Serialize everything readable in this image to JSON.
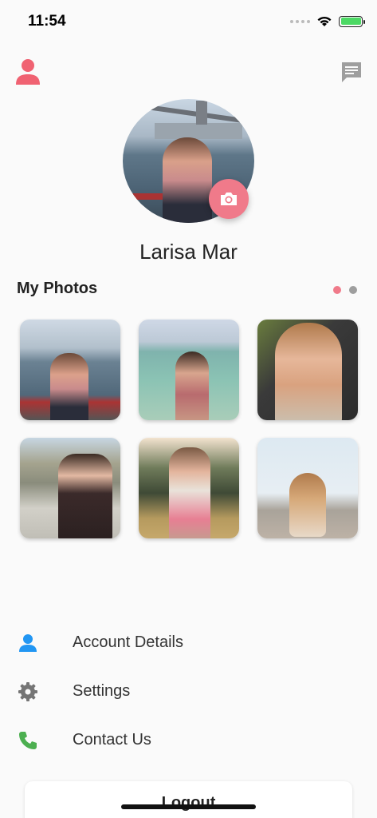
{
  "status_bar": {
    "time": "11:54"
  },
  "profile": {
    "name": "Larisa Mar"
  },
  "photos_section": {
    "title": "My Photos",
    "page_count": 2,
    "active_page": 1
  },
  "photos": [
    {
      "subject": "woman at waterfront by bridge"
    },
    {
      "subject": "woman in sea"
    },
    {
      "subject": "woman selfie in car"
    },
    {
      "subject": "woman sitting by river"
    },
    {
      "subject": "woman outdoors with sunglasses"
    },
    {
      "subject": "dog on beach"
    }
  ],
  "menu": [
    {
      "label": "Account Details",
      "icon": "person-icon",
      "color": "#2196f3"
    },
    {
      "label": "Settings",
      "icon": "gear-icon",
      "color": "#757575"
    },
    {
      "label": "Contact Us",
      "icon": "phone-icon",
      "color": "#4caf50"
    }
  ],
  "logout": {
    "label": "Logout"
  },
  "colors": {
    "accent": "#f07a8a",
    "dot_inactive": "#9e9e9e"
  }
}
